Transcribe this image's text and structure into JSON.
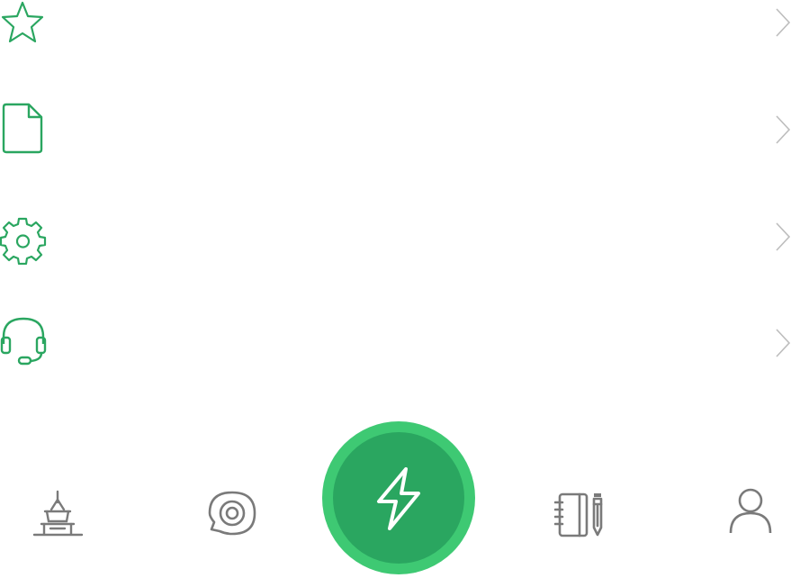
{
  "colors": {
    "accent": "#2aa660",
    "accent_light": "#3ec973",
    "tab_icon": "#7a7a7a",
    "chevron": "#bdbdbd"
  },
  "menu": {
    "items": [
      {
        "icon": "star-icon",
        "label": ""
      },
      {
        "icon": "document-icon",
        "label": ""
      },
      {
        "icon": "gear-icon",
        "label": ""
      },
      {
        "icon": "headset-icon",
        "label": ""
      }
    ]
  },
  "tabbar": {
    "tabs": [
      {
        "icon": "tower-icon"
      },
      {
        "icon": "chat-target-icon"
      },
      {
        "icon": "lightning-icon",
        "center": true
      },
      {
        "icon": "notebook-pencil-icon"
      },
      {
        "icon": "user-icon"
      }
    ]
  }
}
